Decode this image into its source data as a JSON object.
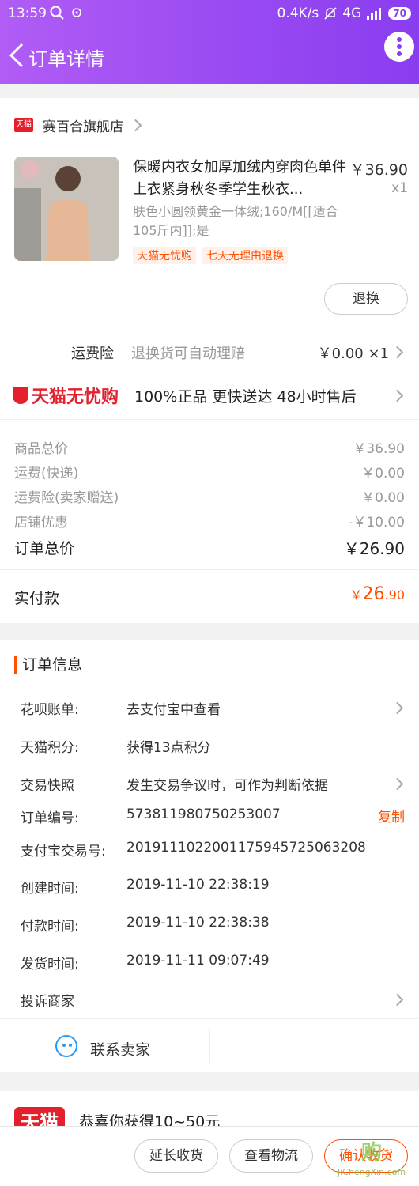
{
  "statusbar": {
    "time": "13:59",
    "net_speed": "0.4K/s",
    "network": "4G",
    "battery": "70"
  },
  "header": {
    "title": "订单详情"
  },
  "shop": {
    "badge": "天猫",
    "name": "赛百合旗舰店"
  },
  "product": {
    "title": "保暖内衣女加厚加绒内穿肉色单件上衣紧身秋冬季学生秋衣...",
    "price": "￥36.90",
    "qty": "x1",
    "sku": "肤色小圆领黄金一体绒;160/M[[适合105斤内]];是",
    "tags": [
      "天猫无忧购",
      "七天无理由退换"
    ],
    "exchange_button": "退换"
  },
  "insurance": {
    "label": "运费险",
    "desc": "退换货可自动理赔",
    "value": "￥0.00 ×1"
  },
  "wyg": {
    "logo": "天猫无忧购",
    "features": "100%正品  更快送达  48小时售后"
  },
  "prices": [
    {
      "label": "商品总价",
      "value": "￥36.90"
    },
    {
      "label": "运费(快递)",
      "value": "￥0.00"
    },
    {
      "label": "运费险(卖家赠送)",
      "value": "￥0.00"
    },
    {
      "label": "店铺优惠",
      "value": "-￥10.00"
    },
    {
      "label": "订单总价",
      "value": "￥26.90"
    }
  ],
  "paid": {
    "label": "实付款",
    "symbol": "￥",
    "int": "26",
    "dec": ".90"
  },
  "order_info": {
    "title": "订单信息",
    "rows": [
      {
        "k": "花呗账单:",
        "v": "去支付宝中查看"
      },
      {
        "k": "天猫积分:",
        "v": "获得13点积分"
      },
      {
        "k": "交易快照",
        "v": "发生交易争议时，可作为判断依据"
      },
      {
        "k": "订单编号:",
        "v": "573811980750253007"
      },
      {
        "k": "支付宝交易号:",
        "v": "2019111022001175945725063208"
      },
      {
        "k": "创建时间:",
        "v": "2019-11-10 22:38:19"
      },
      {
        "k": "付款时间:",
        "v": "2019-11-10 22:38:38"
      },
      {
        "k": "发货时间:",
        "v": "2019-11-11 09:07:49"
      },
      {
        "k": "投诉商家",
        "v": ""
      }
    ],
    "copy_label": "复制"
  },
  "contact": {
    "label": "联系卖家"
  },
  "promo": {
    "badge": "天猫",
    "text": "恭喜你获得10~50元"
  },
  "bottom": {
    "extend": "延长收货",
    "logistics": "查看物流",
    "confirm": "确认收货"
  },
  "watermark": {
    "main": "购",
    "site": "JiChengXin.com"
  },
  "colors": {
    "accent": "#ff5000",
    "header": "#9b4cf2",
    "tmall_red": "#e5202d",
    "contact_blue": "#2b9af3"
  }
}
